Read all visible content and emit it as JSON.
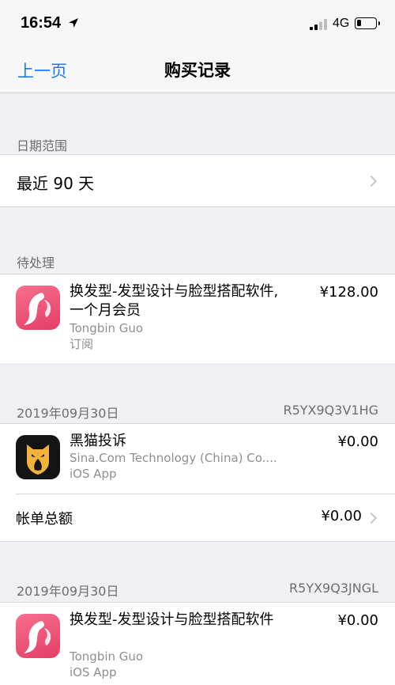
{
  "status_bar": {
    "time": "16:54",
    "network": "4G",
    "location_icon": "location-arrow-icon",
    "signal_icon": "signal-bars-icon",
    "battery_icon": "battery-icon",
    "battery_level": 0.25
  },
  "nav": {
    "back_label": "上一页",
    "title": "购买记录"
  },
  "date_range": {
    "header": "日期范围",
    "value": "最近 90 天"
  },
  "pending": {
    "header": "待处理",
    "item": {
      "icon": "hairstyle-app-icon",
      "name": "换发型-发型设计与脸型搭配软件, 一个月会员",
      "developer": "Tongbin Guo",
      "type": "订阅",
      "price": "¥128.00"
    }
  },
  "orders": [
    {
      "date": "2019年09月30日",
      "order_id": "R5YX9Q3V1HG",
      "item": {
        "icon": "black-cat-app-icon",
        "name": "黑猫投诉",
        "developer": "Sina.Com Technology (China) Co....",
        "type": "iOS App",
        "price": "¥0.00"
      },
      "total_label": "帐单总额",
      "total_value": "¥0.00"
    },
    {
      "date": "2019年09月30日",
      "order_id": "R5YX9Q3JNGL",
      "item": {
        "icon": "hairstyle-app-icon",
        "name": "换发型-发型设计与脸型搭配软件",
        "developer": "Tongbin Guo",
        "type": "iOS App",
        "price": "¥0.00"
      }
    }
  ],
  "colors": {
    "accent": "#1a7cf5",
    "background": "#efeff4",
    "secondary_text": "#8e8e93"
  }
}
